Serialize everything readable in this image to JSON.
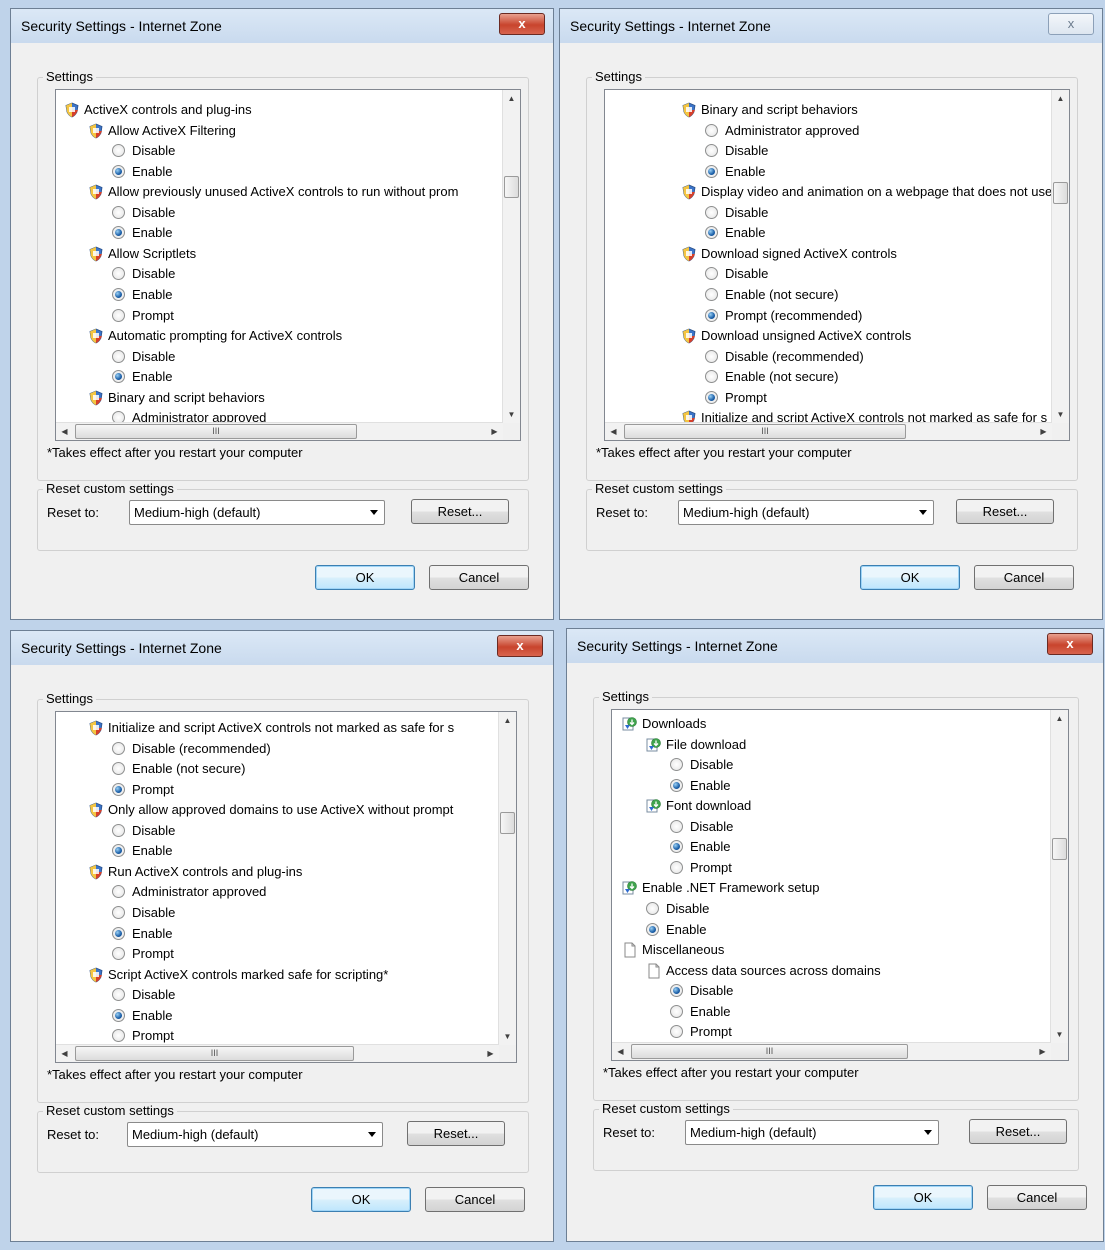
{
  "dialogs": [
    {
      "title": "Security Settings - Internet Zone",
      "close_label": "x",
      "settings_label": "Settings",
      "items": [
        {
          "kind": "shield",
          "level": 0,
          "text": "ActiveX controls and plug-ins"
        },
        {
          "kind": "shield",
          "level": 1,
          "text": "Allow ActiveX Filtering"
        },
        {
          "kind": "radio",
          "level": 2,
          "text": "Disable",
          "checked": false
        },
        {
          "kind": "radio",
          "level": 2,
          "text": "Enable",
          "checked": true
        },
        {
          "kind": "shield",
          "level": 1,
          "text": "Allow previously unused ActiveX controls to run without prom"
        },
        {
          "kind": "radio",
          "level": 2,
          "text": "Disable",
          "checked": false
        },
        {
          "kind": "radio",
          "level": 2,
          "text": "Enable",
          "checked": true
        },
        {
          "kind": "shield",
          "level": 1,
          "text": "Allow Scriptlets"
        },
        {
          "kind": "radio",
          "level": 2,
          "text": "Disable",
          "checked": false
        },
        {
          "kind": "radio",
          "level": 2,
          "text": "Enable",
          "checked": true
        },
        {
          "kind": "radio",
          "level": 2,
          "text": "Prompt",
          "checked": false
        },
        {
          "kind": "shield",
          "level": 1,
          "text": "Automatic prompting for ActiveX controls"
        },
        {
          "kind": "radio",
          "level": 2,
          "text": "Disable",
          "checked": false
        },
        {
          "kind": "radio",
          "level": 2,
          "text": "Enable",
          "checked": true
        },
        {
          "kind": "shield",
          "level": 1,
          "text": "Binary and script behaviors"
        },
        {
          "kind": "radio",
          "level": 2,
          "text": "Administrator approved",
          "checked": false
        }
      ],
      "scroll_position": 0.25,
      "note": "*Takes effect after you restart your computer",
      "reset_group_label": "Reset custom settings",
      "reset_to_label": "Reset to:",
      "reset_value": "Medium-high (default)",
      "reset_button": "Reset...",
      "ok_button": "OK",
      "cancel_button": "Cancel"
    },
    {
      "title": "Security Settings - Internet Zone",
      "close_label": "x",
      "settings_label": "Settings",
      "items": [
        {
          "kind": "shield",
          "level": 1,
          "text": "Binary and script behaviors"
        },
        {
          "kind": "radio",
          "level": 2,
          "text": "Administrator approved",
          "checked": false
        },
        {
          "kind": "radio",
          "level": 2,
          "text": "Disable",
          "checked": false
        },
        {
          "kind": "radio",
          "level": 2,
          "text": "Enable",
          "checked": true
        },
        {
          "kind": "shield",
          "level": 1,
          "text": "Display video and animation on a webpage that does not use"
        },
        {
          "kind": "radio",
          "level": 2,
          "text": "Disable",
          "checked": false
        },
        {
          "kind": "radio",
          "level": 2,
          "text": "Enable",
          "checked": true
        },
        {
          "kind": "shield",
          "level": 1,
          "text": "Download signed ActiveX controls"
        },
        {
          "kind": "radio",
          "level": 2,
          "text": "Disable",
          "checked": false
        },
        {
          "kind": "radio",
          "level": 2,
          "text": "Enable (not secure)",
          "checked": false
        },
        {
          "kind": "radio",
          "level": 2,
          "text": "Prompt (recommended)",
          "checked": true
        },
        {
          "kind": "shield",
          "level": 1,
          "text": "Download unsigned ActiveX controls"
        },
        {
          "kind": "radio",
          "level": 2,
          "text": "Disable (recommended)",
          "checked": false
        },
        {
          "kind": "radio",
          "level": 2,
          "text": "Enable (not secure)",
          "checked": false
        },
        {
          "kind": "radio",
          "level": 2,
          "text": "Prompt",
          "checked": true
        },
        {
          "kind": "shield",
          "level": 1,
          "text": "Initialize and script ActiveX controls not marked as safe for s"
        }
      ],
      "scroll_position": 0.27,
      "note": "*Takes effect after you restart your computer",
      "reset_group_label": "Reset custom settings",
      "reset_to_label": "Reset to:",
      "reset_value": "Medium-high (default)",
      "reset_button": "Reset...",
      "ok_button": "OK",
      "cancel_button": "Cancel"
    },
    {
      "title": "Security Settings - Internet Zone",
      "close_label": "x",
      "settings_label": "Settings",
      "items": [
        {
          "kind": "shield",
          "level": 1,
          "text": "Initialize and script ActiveX controls not marked as safe for s"
        },
        {
          "kind": "radio",
          "level": 2,
          "text": "Disable (recommended)",
          "checked": false
        },
        {
          "kind": "radio",
          "level": 2,
          "text": "Enable (not secure)",
          "checked": false
        },
        {
          "kind": "radio",
          "level": 2,
          "text": "Prompt",
          "checked": true
        },
        {
          "kind": "shield",
          "level": 1,
          "text": "Only allow approved domains to use ActiveX without prompt"
        },
        {
          "kind": "radio",
          "level": 2,
          "text": "Disable",
          "checked": false
        },
        {
          "kind": "radio",
          "level": 2,
          "text": "Enable",
          "checked": true
        },
        {
          "kind": "shield",
          "level": 1,
          "text": "Run ActiveX controls and plug-ins"
        },
        {
          "kind": "radio",
          "level": 2,
          "text": "Administrator approved",
          "checked": false
        },
        {
          "kind": "radio",
          "level": 2,
          "text": "Disable",
          "checked": false
        },
        {
          "kind": "radio",
          "level": 2,
          "text": "Enable",
          "checked": true
        },
        {
          "kind": "radio",
          "level": 2,
          "text": "Prompt",
          "checked": false
        },
        {
          "kind": "shield",
          "level": 1,
          "text": "Script ActiveX controls marked safe for scripting*"
        },
        {
          "kind": "radio",
          "level": 2,
          "text": "Disable",
          "checked": false
        },
        {
          "kind": "radio",
          "level": 2,
          "text": "Enable",
          "checked": true
        },
        {
          "kind": "radio",
          "level": 2,
          "text": "Prompt",
          "checked": false
        }
      ],
      "scroll_position": 0.3,
      "note": "*Takes effect after you restart your computer",
      "reset_group_label": "Reset custom settings",
      "reset_to_label": "Reset to:",
      "reset_value": "Medium-high (default)",
      "reset_button": "Reset...",
      "ok_button": "OK",
      "cancel_button": "Cancel"
    },
    {
      "title": "Security Settings - Internet Zone",
      "close_label": "x",
      "settings_label": "Settings",
      "items": [
        {
          "kind": "download",
          "level": 0,
          "text": "Downloads"
        },
        {
          "kind": "download",
          "level": 1,
          "text": "File download"
        },
        {
          "kind": "radio",
          "level": 2,
          "text": "Disable",
          "checked": false
        },
        {
          "kind": "radio",
          "level": 2,
          "text": "Enable",
          "checked": true
        },
        {
          "kind": "download",
          "level": 1,
          "text": "Font download"
        },
        {
          "kind": "radio",
          "level": 2,
          "text": "Disable",
          "checked": false
        },
        {
          "kind": "radio",
          "level": 2,
          "text": "Enable",
          "checked": true
        },
        {
          "kind": "radio",
          "level": 2,
          "text": "Prompt",
          "checked": false
        },
        {
          "kind": "download",
          "level": 0,
          "text": "Enable .NET Framework setup"
        },
        {
          "kind": "radio",
          "level": 1,
          "text": "Disable",
          "checked": false
        },
        {
          "kind": "radio",
          "level": 1,
          "text": "Enable",
          "checked": true
        },
        {
          "kind": "page",
          "level": 0,
          "text": "Miscellaneous"
        },
        {
          "kind": "page",
          "level": 1,
          "text": "Access data sources across domains"
        },
        {
          "kind": "radio",
          "level": 2,
          "text": "Disable",
          "checked": true
        },
        {
          "kind": "radio",
          "level": 2,
          "text": "Enable",
          "checked": false
        },
        {
          "kind": "radio",
          "level": 2,
          "text": "Prompt",
          "checked": false
        }
      ],
      "scroll_position": 0.4,
      "note": "*Takes effect after you restart your computer",
      "reset_group_label": "Reset custom settings",
      "reset_to_label": "Reset to:",
      "reset_value": "Medium-high (default)",
      "reset_button": "Reset...",
      "ok_button": "OK",
      "cancel_button": "Cancel"
    }
  ]
}
